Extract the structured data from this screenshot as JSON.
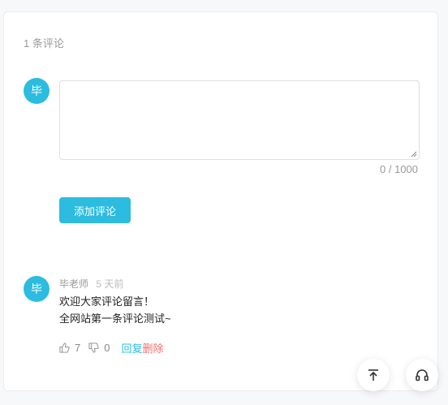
{
  "comments": {
    "count_label": "1 条评论",
    "avatar_text": "毕",
    "editor": {
      "value": "",
      "limit_label": "0 / 1000"
    },
    "add_button_label": "添加评论",
    "items": [
      {
        "avatar_text": "毕",
        "author": "毕老师",
        "time": "5 天前",
        "content": " 欢迎大家评论留言！\n全网站第一条评论测试~",
        "likes": "7",
        "dislikes": "0",
        "reply_label": "回复",
        "delete_label": "删除"
      }
    ]
  },
  "floating": {
    "top_icon": "back-to-top-icon",
    "audio_icon": "headphones-icon"
  },
  "colors": {
    "accent": "#2bbcdf",
    "danger": "#f56c6c"
  }
}
